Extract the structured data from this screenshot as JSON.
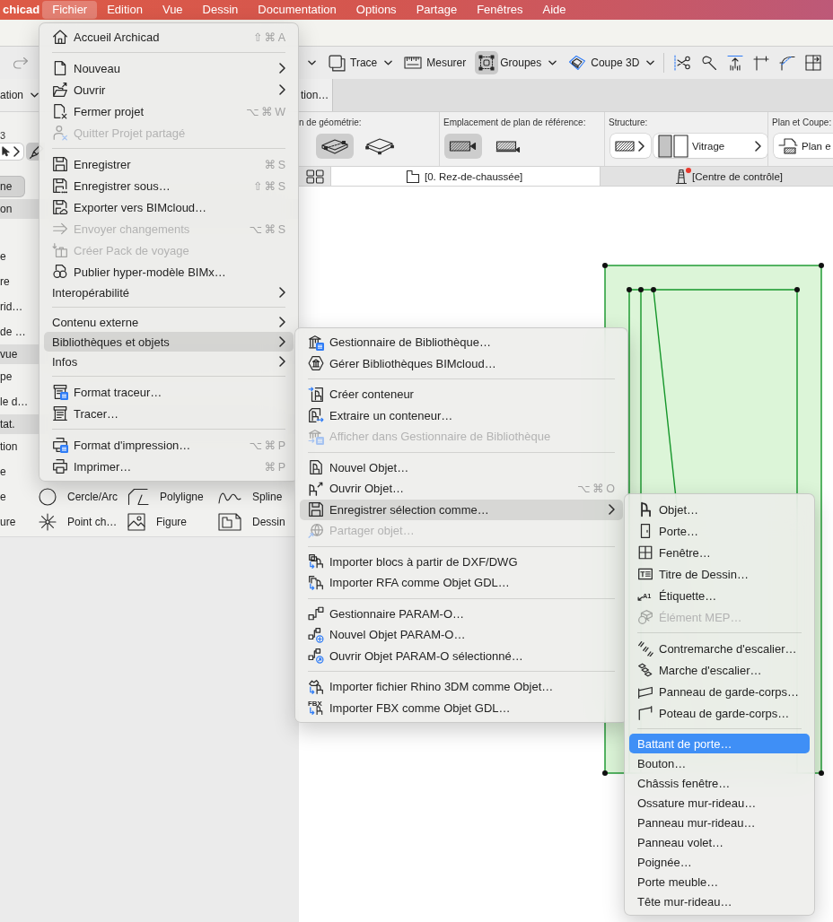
{
  "menu_bar": {
    "app": "chicad",
    "items": [
      {
        "label": "Fichier",
        "selected": true
      },
      {
        "label": "Edition",
        "selected": false
      },
      {
        "label": "Vue",
        "selected": false
      },
      {
        "label": "Dessin",
        "selected": false
      },
      {
        "label": "Documentation",
        "selected": false
      },
      {
        "label": "Options",
        "selected": false
      },
      {
        "label": "Partage",
        "selected": false
      },
      {
        "label": "Fenêtres",
        "selected": false
      },
      {
        "label": "Aide",
        "selected": false
      }
    ]
  },
  "toolbar": {
    "tools": [
      {
        "label": "Trace",
        "kind": "dropdown",
        "selected": false
      },
      {
        "label": "Mesurer",
        "kind": "button",
        "selected": false
      },
      {
        "label": "Groupes",
        "kind": "dropdown",
        "selected": true
      },
      {
        "label": "Coupe 3D",
        "kind": "dropdown",
        "selected": false
      }
    ]
  },
  "tab_strip": {
    "dropdown": "ation",
    "tabs": [
      {
        "label": "tion…",
        "selected": true
      }
    ]
  },
  "toolbox": {
    "caption": "3",
    "rows": [
      {
        "kind": "tools",
        "cells": [
          {
            "label": "ne",
            "selected": true
          }
        ]
      },
      {
        "kind": "group",
        "label": "on"
      },
      {
        "kind": "blank"
      },
      {
        "kind": "tools",
        "cells": [
          {
            "label": "e",
            "selected": false
          }
        ]
      },
      {
        "kind": "tools",
        "cells": [
          {
            "label": "re",
            "selected": false
          }
        ]
      },
      {
        "kind": "tools",
        "cells": [
          {
            "label": "rid…",
            "selected": false
          }
        ]
      },
      {
        "kind": "tools",
        "cells": [
          {
            "label": "de …",
            "selected": false
          }
        ]
      },
      {
        "kind": "group",
        "label": "vue"
      },
      {
        "kind": "tools",
        "cells": [
          {
            "label": "pe",
            "selected": false
          }
        ]
      },
      {
        "kind": "tools",
        "cells": [
          {
            "label": "le d…",
            "selected": false
          }
        ]
      },
      {
        "kind": "group",
        "label": "tat."
      },
      {
        "kind": "tools",
        "cells": [
          {
            "label": "tion",
            "selected": false
          }
        ]
      },
      {
        "kind": "tools",
        "cells": [
          {
            "label": "e",
            "selected": false
          }
        ]
      },
      {
        "kind": "tools",
        "cells": [
          {
            "label": "e",
            "selected": false
          },
          {
            "label": "Cercle/Arc",
            "selected": false
          },
          {
            "label": "Polyligne",
            "selected": false
          },
          {
            "label": "Spline",
            "selected": false
          }
        ]
      },
      {
        "kind": "tools",
        "cells": [
          {
            "label": "ure",
            "selected": false
          },
          {
            "label": "Point ch…",
            "selected": false
          },
          {
            "label": "Figure",
            "selected": false
          },
          {
            "label": "Dessin",
            "selected": false
          }
        ]
      }
    ]
  },
  "info_box": [
    {
      "label": "n de géométrie:",
      "kind": "options",
      "options": [
        {
          "selected": true
        },
        {
          "selected": false
        }
      ]
    },
    {
      "label": "Emplacement de plan de référence:",
      "kind": "options",
      "options": [
        {
          "selected": true
        },
        {
          "selected": false
        }
      ]
    },
    {
      "label": "Structure:",
      "kind": "pickers",
      "pickers": [
        {
          "kind": "swatch",
          "chevron": true
        },
        {
          "kind": "value",
          "value": "Vitrage",
          "chevron": true
        }
      ]
    },
    {
      "label": "Plan et Coupe:",
      "kind": "pickers",
      "pickers": [
        {
          "kind": "value",
          "value": "Plan e"
        }
      ]
    }
  ],
  "view_tabs": [
    {
      "label": "[0. Rez-de-chaussée]",
      "selected": true,
      "notification": false
    },
    {
      "label": "[Centre de contrôle]",
      "selected": false,
      "notification": true
    }
  ],
  "file_menu": {
    "sections": [
      [
        {
          "label": "Accueil Archicad",
          "kind": "icon",
          "shortcut": "⇧⌘A",
          "submenu": false,
          "disabled": false,
          "selected": false
        }
      ],
      [
        {
          "label": "Nouveau",
          "kind": "icon",
          "submenu": true,
          "disabled": false,
          "selected": false
        },
        {
          "label": "Ouvrir",
          "kind": "icon",
          "submenu": true,
          "disabled": false,
          "selected": false
        },
        {
          "label": "Fermer projet",
          "kind": "icon",
          "shortcut": "⌥⌘W",
          "submenu": false,
          "disabled": false,
          "selected": false
        },
        {
          "label": "Quitter Projet partagé",
          "kind": "icon",
          "submenu": false,
          "disabled": true,
          "selected": false
        }
      ],
      [
        {
          "label": "Enregistrer",
          "kind": "icon",
          "shortcut": "⌘S",
          "submenu": false,
          "disabled": false,
          "selected": false
        },
        {
          "label": "Enregistrer sous…",
          "kind": "icon",
          "shortcut": "⇧⌘S",
          "submenu": false,
          "disabled": false,
          "selected": false
        },
        {
          "label": "Exporter vers BIMcloud…",
          "kind": "icon",
          "submenu": false,
          "disabled": false,
          "selected": false
        },
        {
          "label": "Envoyer changements",
          "kind": "icon",
          "shortcut": "⌥⌘S",
          "submenu": false,
          "disabled": true,
          "selected": false
        },
        {
          "label": "Créer Pack de voyage",
          "kind": "icon",
          "submenu": false,
          "disabled": true,
          "selected": false
        },
        {
          "label": "Publier hyper-modèle BIMx…",
          "kind": "icon",
          "submenu": false,
          "disabled": false,
          "selected": false
        },
        {
          "label": "Interopérabilité",
          "kind": "text",
          "submenu": true,
          "disabled": false,
          "selected": false
        }
      ],
      [
        {
          "label": "Contenu externe",
          "kind": "text",
          "submenu": true,
          "disabled": false,
          "selected": false
        },
        {
          "label": "Bibliothèques et objets",
          "kind": "text",
          "submenu": true,
          "disabled": false,
          "selected": true
        },
        {
          "label": "Infos",
          "kind": "text",
          "submenu": true,
          "disabled": false,
          "selected": false
        }
      ],
      [
        {
          "label": "Format traceur…",
          "kind": "icon",
          "submenu": false,
          "disabled": false,
          "selected": false
        },
        {
          "label": "Tracer…",
          "kind": "icon",
          "submenu": false,
          "disabled": false,
          "selected": false
        }
      ],
      [
        {
          "label": "Format d'impression…",
          "kind": "icon",
          "shortcut": "⌥⌘P",
          "submenu": false,
          "disabled": false,
          "selected": false
        },
        {
          "label": "Imprimer…",
          "kind": "icon",
          "shortcut": "⌘P",
          "submenu": false,
          "disabled": false,
          "selected": false
        }
      ]
    ]
  },
  "libraries_menu": {
    "sections": [
      [
        {
          "label": "Gestionnaire de Bibliothèque…",
          "kind": "icon",
          "submenu": false,
          "disabled": false,
          "selected": false
        },
        {
          "label": "Gérer Bibliothèques BIMcloud…",
          "kind": "icon",
          "submenu": false,
          "disabled": false,
          "selected": false
        }
      ],
      [
        {
          "label": "Créer conteneur",
          "kind": "icon",
          "submenu": false,
          "disabled": false,
          "selected": false
        },
        {
          "label": "Extraire un conteneur…",
          "kind": "icon",
          "submenu": false,
          "disabled": false,
          "selected": false
        },
        {
          "label": "Afficher dans Gestionnaire de Bibliothèque",
          "kind": "icon",
          "submenu": false,
          "disabled": true,
          "selected": false
        }
      ],
      [
        {
          "label": "Nouvel Objet…",
          "kind": "icon",
          "submenu": false,
          "disabled": false,
          "selected": false
        },
        {
          "label": "Ouvrir Objet…",
          "kind": "icon",
          "shortcut": "⌥⌘O",
          "submenu": false,
          "disabled": false,
          "selected": false
        },
        {
          "label": "Enregistrer sélection comme…",
          "kind": "icon",
          "submenu": true,
          "disabled": false,
          "selected": true
        },
        {
          "label": "Partager objet…",
          "kind": "icon",
          "submenu": false,
          "disabled": true,
          "selected": false
        }
      ],
      [
        {
          "label": "Importer blocs à partir de DXF/DWG",
          "kind": "icon",
          "submenu": false,
          "disabled": false,
          "selected": false
        },
        {
          "label": "Importer RFA comme Objet GDL…",
          "kind": "icon",
          "submenu": false,
          "disabled": false,
          "selected": false
        }
      ],
      [
        {
          "label": "Gestionnaire PARAM-O…",
          "kind": "icon",
          "submenu": false,
          "disabled": false,
          "selected": false
        },
        {
          "label": "Nouvel Objet PARAM-O…",
          "kind": "icon",
          "submenu": false,
          "disabled": false,
          "selected": false
        },
        {
          "label": "Ouvrir Objet PARAM-O sélectionné…",
          "kind": "icon",
          "submenu": false,
          "disabled": false,
          "selected": false
        }
      ],
      [
        {
          "label": "Importer fichier Rhino 3DM comme Objet…",
          "kind": "icon",
          "submenu": false,
          "disabled": false,
          "selected": false
        },
        {
          "label": "Importer FBX comme Objet GDL…",
          "kind": "icon",
          "icon_label": "FBX",
          "submenu": false,
          "disabled": false,
          "selected": false
        }
      ]
    ]
  },
  "save_as_menu": {
    "sections": [
      [
        {
          "label": "Objet…",
          "kind": "icon",
          "submenu": false,
          "disabled": false,
          "selected": false
        },
        {
          "label": "Porte…",
          "kind": "icon",
          "submenu": false,
          "disabled": false,
          "selected": false
        },
        {
          "label": "Fenêtre…",
          "kind": "icon",
          "submenu": false,
          "disabled": false,
          "selected": false
        },
        {
          "label": "Titre de Dessin…",
          "kind": "icon",
          "submenu": false,
          "disabled": false,
          "selected": false
        },
        {
          "label": "Étiquette…",
          "kind": "icon",
          "icon_label": "A1",
          "submenu": false,
          "disabled": false,
          "selected": false
        },
        {
          "label": "Élément MEP…",
          "kind": "icon",
          "submenu": false,
          "disabled": true,
          "selected": false
        }
      ],
      [
        {
          "label": "Contremarche d'escalier…",
          "kind": "icon",
          "submenu": false,
          "disabled": false,
          "selected": false
        },
        {
          "label": "Marche d'escalier…",
          "kind": "icon",
          "submenu": false,
          "disabled": false,
          "selected": false
        },
        {
          "label": "Panneau de garde-corps…",
          "kind": "icon",
          "submenu": false,
          "disabled": false,
          "selected": false
        },
        {
          "label": "Poteau de garde-corps…",
          "kind": "icon",
          "submenu": false,
          "disabled": false,
          "selected": false
        }
      ],
      [
        {
          "label": "Battant de porte…",
          "kind": "text",
          "submenu": false,
          "disabled": false,
          "selected": true
        },
        {
          "label": "Bouton…",
          "kind": "text",
          "submenu": false,
          "disabled": false,
          "selected": false
        },
        {
          "label": "Châssis fenêtre…",
          "kind": "text",
          "submenu": false,
          "disabled": false,
          "selected": false
        },
        {
          "label": "Ossature mur-rideau…",
          "kind": "text",
          "submenu": false,
          "disabled": false,
          "selected": false
        },
        {
          "label": "Panneau mur-rideau…",
          "kind": "text",
          "submenu": false,
          "disabled": false,
          "selected": false
        },
        {
          "label": "Panneau volet…",
          "kind": "text",
          "submenu": false,
          "disabled": false,
          "selected": false
        },
        {
          "label": "Poignée…",
          "kind": "text",
          "submenu": false,
          "disabled": false,
          "selected": false
        },
        {
          "label": "Porte meuble…",
          "kind": "text",
          "submenu": false,
          "disabled": false,
          "selected": false
        },
        {
          "label": "Tête mur-rideau…",
          "kind": "text",
          "submenu": false,
          "disabled": false,
          "selected": false
        }
      ]
    ]
  }
}
